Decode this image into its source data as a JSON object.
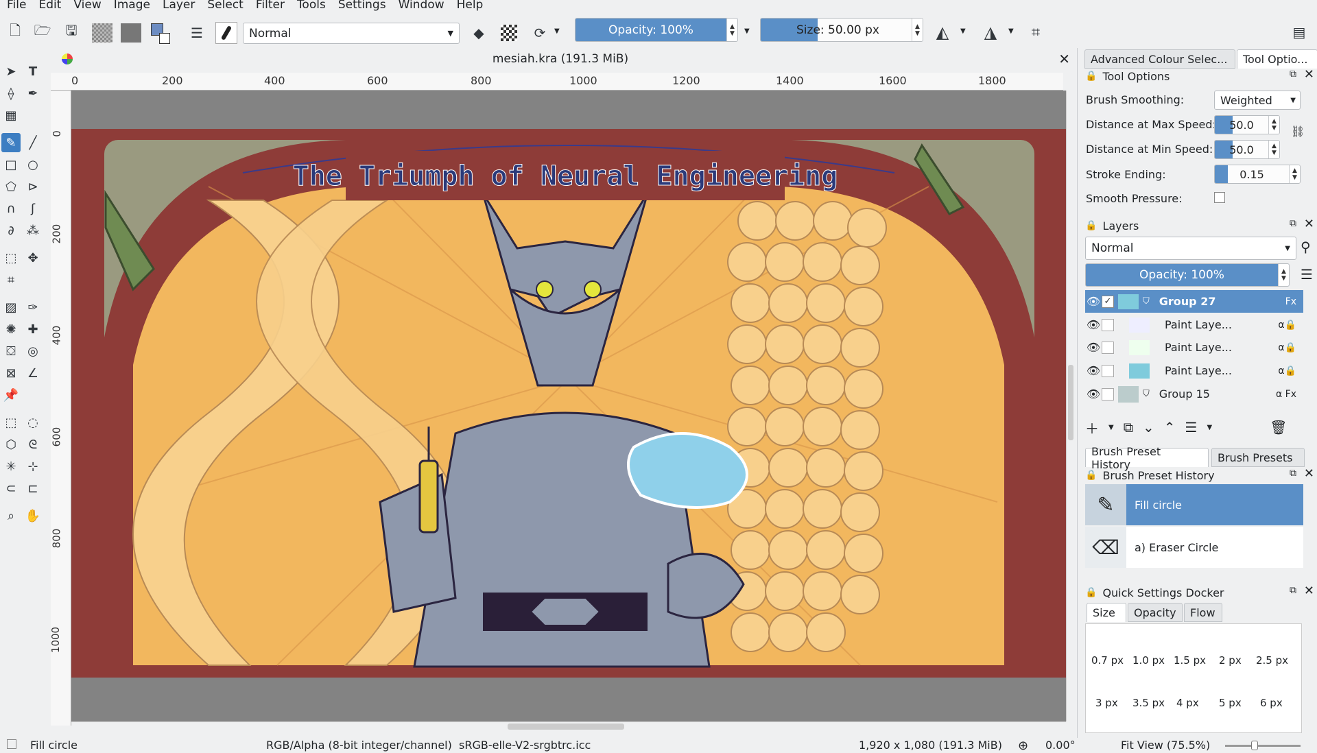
{
  "menu": [
    "File",
    "Edit",
    "View",
    "Image",
    "Layer",
    "Select",
    "Filter",
    "Tools",
    "Settings",
    "Window",
    "Help"
  ],
  "toolbar": {
    "blend_mode": "Normal",
    "opacity_label": "Opacity: 100%",
    "opacity_value": 1.0,
    "size_label": "Size: 50.00 px",
    "size_value": 0.35
  },
  "document": {
    "title": "mesiah.kra (191.3 MiB)",
    "ruler_labels": [
      "0",
      "200",
      "400",
      "600",
      "800",
      "1000",
      "1200",
      "1400",
      "1600",
      "1800"
    ],
    "vruler_labels": [
      "0",
      "200",
      "400",
      "600",
      "800",
      "1000"
    ],
    "canvas_title": "The Triumph of Neural Engineering"
  },
  "dock_tabs": {
    "colour": "Advanced Colour Selec...",
    "tool": "Tool Optio..."
  },
  "tool_options": {
    "header": "Tool Options",
    "brush_smoothing_label": "Brush Smoothing:",
    "brush_smoothing_value": "Weighted",
    "max_speed_label": "Distance at Max Speed:",
    "max_speed_value": "50.0",
    "min_speed_label": "Distance at Min Speed:",
    "min_speed_value": "50.0",
    "stroke_ending_label": "Stroke Ending:",
    "stroke_ending_value": "0.15",
    "smooth_pressure_label": "Smooth Pressure:"
  },
  "layers": {
    "header": "Layers",
    "blend_mode": "Normal",
    "opacity_label": "Opacity: 100%",
    "items": [
      {
        "name": "Group 27"
      },
      {
        "name": "Paint Laye..."
      },
      {
        "name": "Paint Laye..."
      },
      {
        "name": "Paint Laye..."
      },
      {
        "name": "Group 15"
      }
    ]
  },
  "brush_tabs": {
    "history": "Brush Preset History",
    "presets": "Brush Presets"
  },
  "brush_history": {
    "header": "Brush Preset History",
    "items": [
      {
        "name": "Fill circle"
      },
      {
        "name": "a) Eraser Circle"
      }
    ]
  },
  "quick_settings": {
    "header": "Quick Settings Docker",
    "tabs": [
      "Size",
      "Opacity",
      "Flow"
    ],
    "sizes": [
      "0.7 px",
      "1.0 px",
      "1.5 px",
      "2 px",
      "2.5 px",
      "3 px",
      "3.5 px",
      "4 px",
      "5 px",
      "6 px"
    ]
  },
  "status": {
    "preset": "Fill circle",
    "color_space": "RGB/Alpha (8-bit integer/channel)  sRGB-elle-V2-srgbtrc.icc",
    "dimensions": "1,920 x 1,080 (191.3 MiB)",
    "rotation": "0.00°",
    "zoom": "Fit View (75.5%)"
  },
  "colors": {
    "accent": "#3d7ec2",
    "frame": "#8e3c38",
    "sky": "#f2b75e",
    "robe": "#8e98ac"
  }
}
